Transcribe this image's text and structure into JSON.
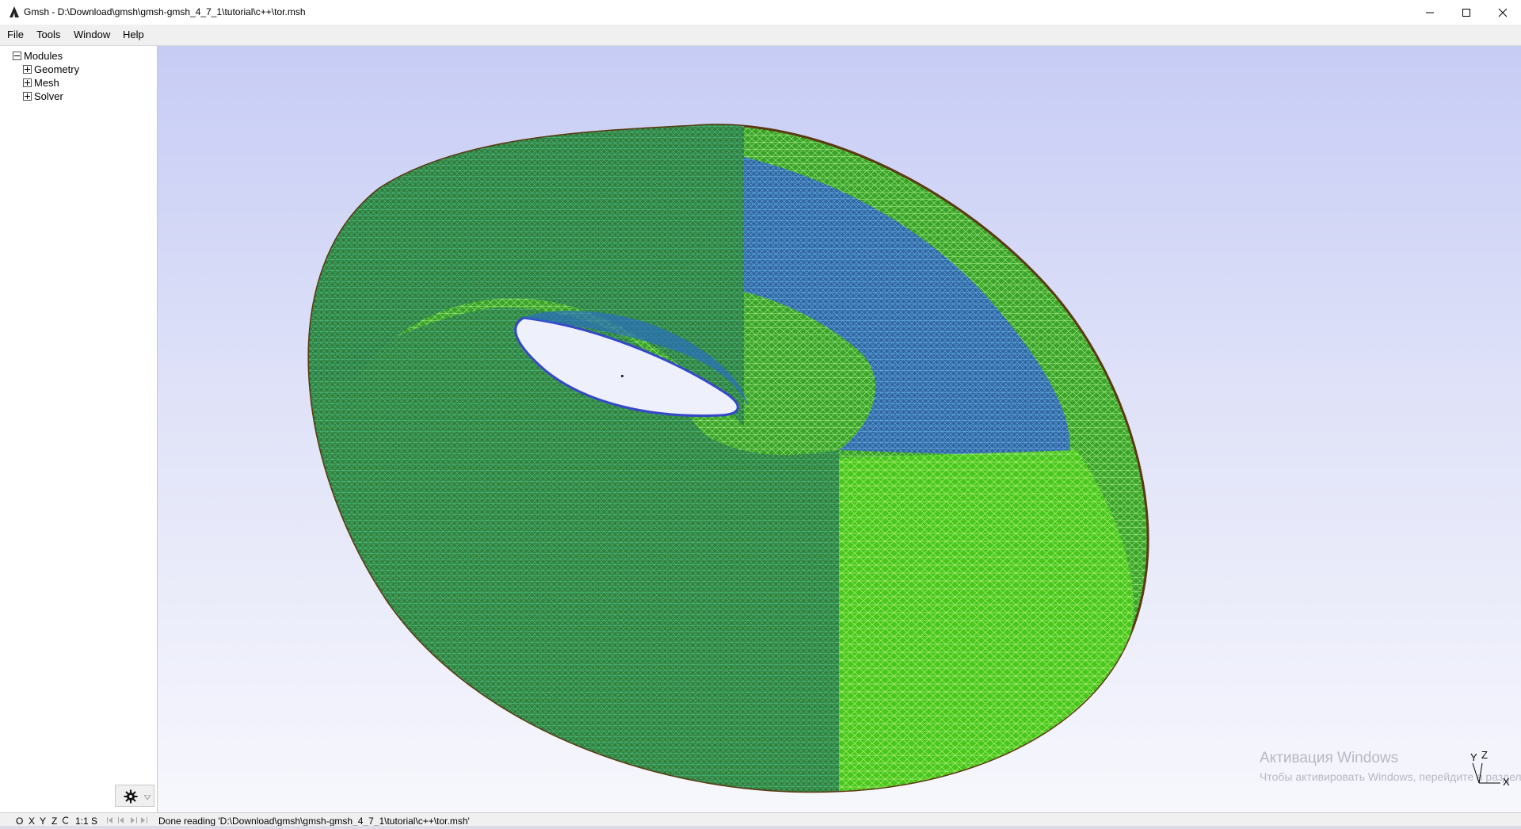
{
  "window": {
    "title": "Gmsh - D:\\Download\\gmsh\\gmsh-gmsh_4_7_1\\tutorial\\c++\\tor.msh"
  },
  "menu": [
    "File",
    "Tools",
    "Window",
    "Help"
  ],
  "tree": {
    "root": "Modules",
    "items": [
      "Geometry",
      "Mesh",
      "Solver"
    ]
  },
  "viewport": {
    "axes": {
      "x": "X",
      "y": "Y",
      "z": "Z"
    },
    "watermark": {
      "title": "Активация Windows",
      "subtitle": "Чтобы активировать Windows, перейдите в раздел \"Параметры\"."
    }
  },
  "status": {
    "buttons": [
      "O",
      "X",
      "Y",
      "Z",
      "1:1",
      "S"
    ],
    "message": "Done reading 'D:\\Download\\gmsh\\gmsh-gmsh_4_7_1\\tutorial\\c++\\tor.msh'"
  },
  "colors": {
    "mesh_green": "#3fb81f",
    "mesh_dark_green": "#2c7a2c",
    "mesh_blue": "#3a4fd0",
    "background_top": "#c7ccf5",
    "background_bottom": "#f7f7fd"
  },
  "icons": [
    "gmsh-app-icon",
    "minimize-icon",
    "maximize-icon",
    "close-icon",
    "gear-icon"
  ]
}
